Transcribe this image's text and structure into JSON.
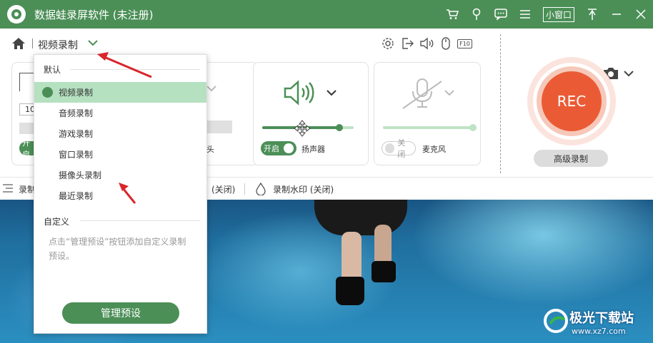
{
  "titlebar": {
    "app_title": "数据蛙录屏软件 (未注册)",
    "mini_window_label": "小窗口",
    "icons": [
      "cart-icon",
      "pin-icon",
      "message-icon",
      "menu-icon",
      "topmost-icon",
      "minimize-icon",
      "close-icon"
    ]
  },
  "toolbar": {
    "mode_label": "视频录制",
    "tool_icons": [
      "settings-icon",
      "export-icon",
      "speaker-icon",
      "mouse-icon",
      "hotkey-icon"
    ],
    "hotkey_label": "F10"
  },
  "panels": {
    "region": {
      "size_value": "10",
      "toggle_label": "开启"
    },
    "webcam": {
      "label_fragment": "头"
    },
    "speaker": {
      "toggle_label": "开启",
      "label": "扬声器",
      "volume": 0.84
    },
    "microphone": {
      "toggle_label": "关闭",
      "label": "麦克风",
      "volume": 1.0
    }
  },
  "rec": {
    "button_label": "REC",
    "advanced_label": "高级录制"
  },
  "bottombar": {
    "left_fragment": "录制",
    "mid_fragment": "(关闭)",
    "watermark_label": "录制水印 (关闭)"
  },
  "dropdown": {
    "default_section": "默认",
    "items": [
      "视频录制",
      "音频录制",
      "游戏录制",
      "窗口录制",
      "摄像头录制",
      "最近录制"
    ],
    "selected_index": 0,
    "custom_section": "自定义",
    "hint": "点击“管理预设”按钮添加自定义录制预设。",
    "manage_button": "管理预设"
  },
  "site_watermark": {
    "title": "极光下载站",
    "url": "www.xz7.com"
  },
  "colors": {
    "brand_green": "#4b8f57",
    "rec_orange": "#ea5b35",
    "arrow_red": "#d9262c"
  }
}
